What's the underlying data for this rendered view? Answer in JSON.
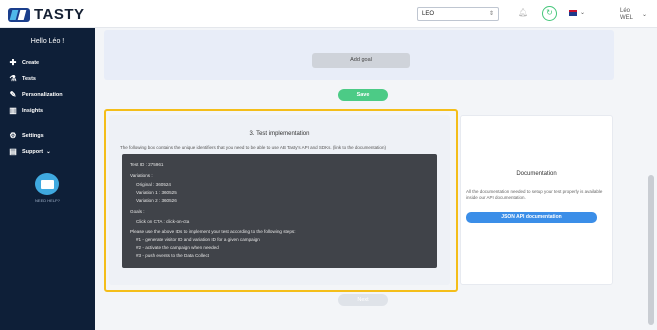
{
  "header": {
    "logo_text": "TASTY",
    "site_select": "LEO",
    "user_name": "Léo",
    "user_surname": "WEL"
  },
  "sidebar": {
    "greeting": "Hello Léo !",
    "items": [
      {
        "label": "Create",
        "icon": "plus-icon"
      },
      {
        "label": "Tests",
        "icon": "flask-icon"
      },
      {
        "label": "Personalization",
        "icon": "pen-icon"
      },
      {
        "label": "Insights",
        "icon": "bar-chart-icon"
      },
      {
        "label": "Settings",
        "icon": "gear-icon"
      },
      {
        "label": "Support",
        "icon": "book-icon"
      }
    ],
    "help_label": "NEED HELP?"
  },
  "goals": {
    "add_goal_label": "Add goal",
    "save_label": "Save"
  },
  "implementation": {
    "title": "3. Test implementation",
    "description": "The following box contains the unique identifiers that you need to be able to use AB Tasty's API and SDKs. (link to the documentation)",
    "code_lines": [
      "Test ID : 275961",
      "Variations :",
      "  Original : 360524",
      "  Variation 1 : 360525",
      "  Variation 2 : 360526",
      "Goals :",
      "  Click on CTA : click-on-cta",
      "Please use the above IDs to implement your test according to the following steps:",
      "  #1 - generate visitor ID and variation ID for a given campaign",
      "  #2 - activate the campaign when needed",
      "  #3 - push events to the Data Collect"
    ]
  },
  "documentation": {
    "title": "Documentation",
    "description": "All the documentation needed to setup your test properly is available inside our API documentation.",
    "button_label": "JSON API documentation"
  },
  "footer": {
    "next_label": "Next"
  },
  "colors": {
    "sidebar_bg": "#0e1f38",
    "accent_green": "#4ccb86",
    "accent_blue": "#3b8ee8",
    "highlight_yellow": "#f4be1a"
  }
}
